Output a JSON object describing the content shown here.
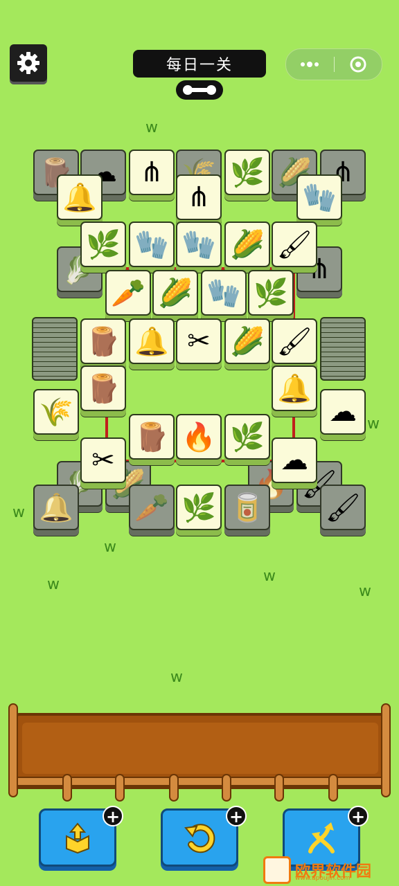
{
  "header": {
    "title": "每日一关",
    "settings_icon": "gear-icon",
    "level_icon": "bone-icon",
    "capsule": {
      "more_icon": "more-dots-icon",
      "close_icon": "target-circle-icon"
    }
  },
  "colors": {
    "background": "#a4e85c",
    "highlight": "#c0201c",
    "tile_face": "#fbfbd9",
    "tray": "#a1520e",
    "powerup": "#29a3ee"
  },
  "board": {
    "tiles": [
      {
        "icon": "stump-icon",
        "state": "covered"
      },
      {
        "icon": "wool-icon",
        "state": "covered"
      },
      {
        "icon": "pitchfork-icon",
        "state": "free"
      },
      {
        "icon": "hay-icon",
        "state": "covered"
      },
      {
        "icon": "grass-icon",
        "state": "free"
      },
      {
        "icon": "corn-icon",
        "state": "covered"
      },
      {
        "icon": "pitchfork-icon",
        "state": "covered"
      },
      {
        "icon": "bell-icon",
        "state": "free"
      },
      {
        "icon": "pitchfork-icon",
        "state": "free"
      },
      {
        "icon": "glove-icon",
        "state": "free"
      },
      {
        "icon": "grass-icon",
        "state": "free"
      },
      {
        "icon": "glove-icon",
        "state": "free"
      },
      {
        "icon": "glove-icon",
        "state": "free"
      },
      {
        "icon": "corn-icon",
        "state": "free"
      },
      {
        "icon": "brush-icon",
        "state": "free"
      },
      {
        "icon": "cabbage-icon",
        "state": "covered"
      },
      {
        "icon": "pitchfork-icon",
        "state": "covered"
      },
      {
        "icon": "carrot-icon",
        "state": "free"
      },
      {
        "icon": "corn-icon",
        "state": "free"
      },
      {
        "icon": "glove-icon",
        "state": "free"
      },
      {
        "icon": "grass-icon",
        "state": "free"
      },
      {
        "icon": "stump-icon",
        "state": "free"
      },
      {
        "icon": "bell-icon",
        "state": "free"
      },
      {
        "icon": "shears-icon",
        "state": "free"
      },
      {
        "icon": "corn-icon",
        "state": "free"
      },
      {
        "icon": "brush-icon",
        "state": "free"
      },
      {
        "icon": "stump-icon",
        "state": "free"
      },
      {
        "icon": "bell-icon",
        "state": "free"
      },
      {
        "icon": "hay-icon",
        "state": "free"
      },
      {
        "icon": "wool-icon",
        "state": "free"
      },
      {
        "icon": "stump-icon",
        "state": "free"
      },
      {
        "icon": "campfire-icon",
        "state": "free"
      },
      {
        "icon": "grass-icon",
        "state": "free"
      },
      {
        "icon": "shears-icon",
        "state": "free"
      },
      {
        "icon": "wool-icon",
        "state": "free"
      },
      {
        "icon": "cabbage-icon",
        "state": "covered"
      },
      {
        "icon": "corn-icon",
        "state": "covered"
      },
      {
        "icon": "campfire-icon",
        "state": "covered"
      },
      {
        "icon": "brush-icon",
        "state": "covered"
      },
      {
        "icon": "bell-icon",
        "state": "covered"
      },
      {
        "icon": "carrot-icon",
        "state": "covered"
      },
      {
        "icon": "grass-icon",
        "state": "free"
      },
      {
        "icon": "milk-can-icon",
        "state": "covered"
      },
      {
        "icon": "brush-icon",
        "state": "covered"
      }
    ],
    "side_stacks": [
      {
        "side": "left"
      },
      {
        "side": "right"
      }
    ]
  },
  "tray": {
    "slots_icon": "fence-tray-icon"
  },
  "powerups": [
    {
      "name": "move-out",
      "icon": "box-out-icon"
    },
    {
      "name": "undo",
      "icon": "undo-icon"
    },
    {
      "name": "shuffle",
      "icon": "shuffle-icon"
    }
  ],
  "watermark": {
    "text": "欧界软件园",
    "url_text": "www.apoujin.com"
  }
}
